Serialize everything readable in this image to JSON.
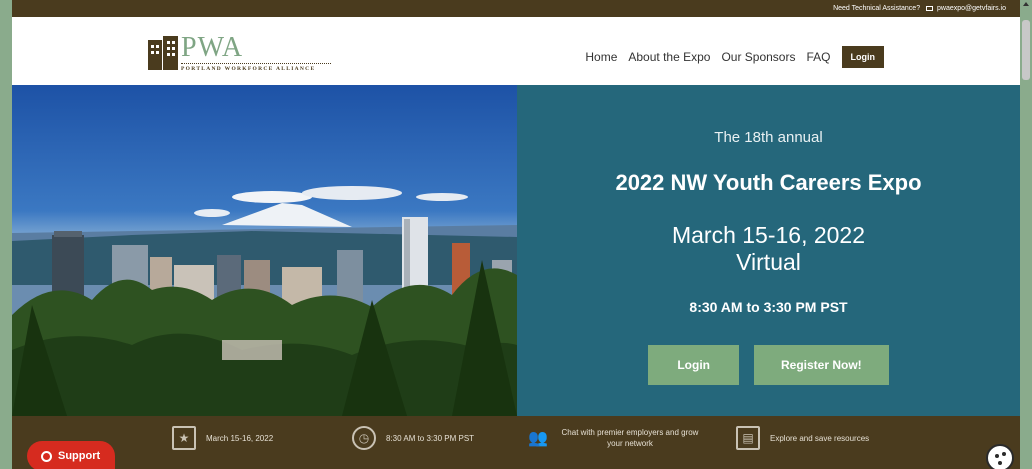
{
  "topbar": {
    "text": "Need Technical Assistance?",
    "email": "pwaexpo@getvfairs.io"
  },
  "logo": {
    "main": "PWA",
    "sub": "PORTLAND WORKFORCE ALLIANCE"
  },
  "nav": {
    "items": [
      "Home",
      "About the Expo",
      "Our Sponsors",
      "FAQ"
    ],
    "login": "Login"
  },
  "hero": {
    "annual": "The 18th annual",
    "title": "2022 NW Youth Careers Expo",
    "dates": "March 15-16, 2022",
    "format": "Virtual",
    "time": "8:30 AM to 3:30 PM PST",
    "login_button": "Login",
    "register_button": "Register Now!"
  },
  "infobar": {
    "items": [
      {
        "icon": "calendar-icon",
        "text": "March 15-16, 2022"
      },
      {
        "icon": "clock-icon",
        "text": "8:30 AM to 3:30 PM PST"
      },
      {
        "icon": "people-icon",
        "text": "Chat with premier employers and grow your network"
      },
      {
        "icon": "backpack-icon",
        "text": "Explore and save resources"
      }
    ]
  },
  "support": {
    "label": "Support"
  },
  "colors": {
    "brown": "#4a3b1e",
    "teal": "#25677b",
    "green": "#7eab7d",
    "support_red": "#d62b1f"
  }
}
